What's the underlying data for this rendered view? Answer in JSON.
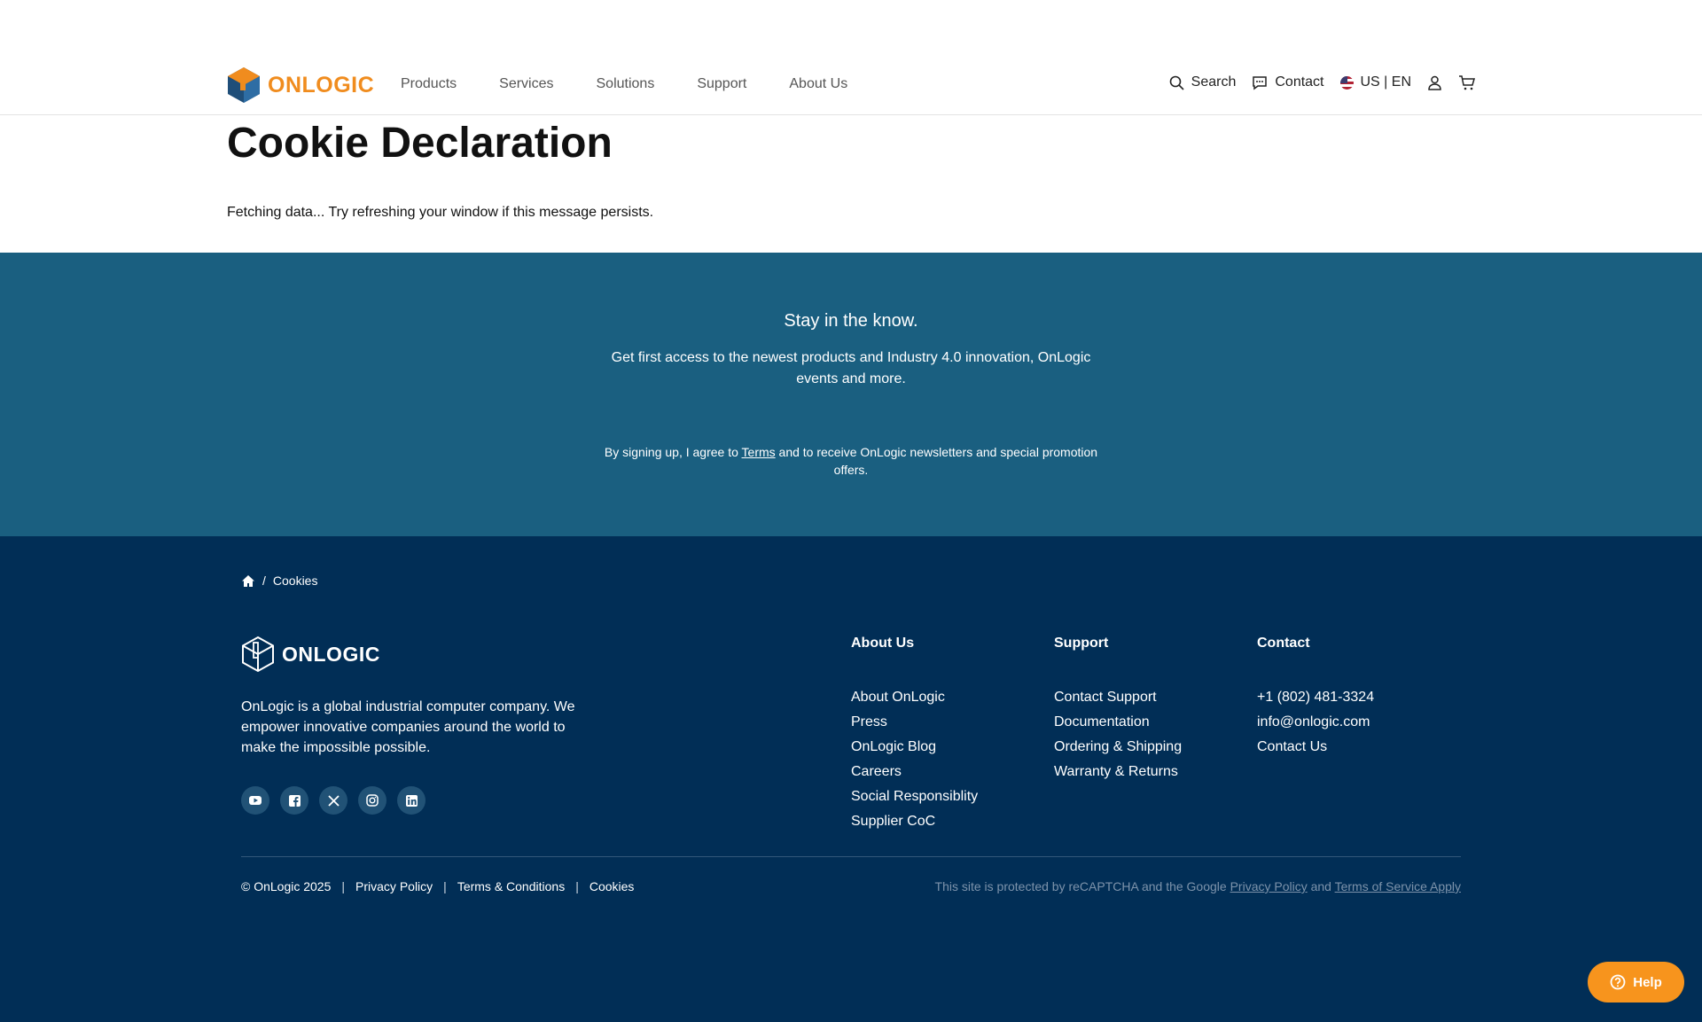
{
  "header": {
    "logo_text": "ONLOGIC",
    "nav": [
      "Products",
      "Services",
      "Solutions",
      "Support",
      "About Us"
    ],
    "search_label": "Search",
    "contact_label": "Contact",
    "locale_label": "US | EN"
  },
  "main": {
    "title": "Cookie Declaration",
    "status": "Fetching data... Try refreshing your window if this message persists."
  },
  "newsletter": {
    "title": "Stay in the know.",
    "description": "Get first access to the newest products and Industry 4.0 innovation, OnLogic events and more.",
    "terms_prefix": "By signing up, I agree to ",
    "terms_link": "Terms",
    "terms_suffix": " and to receive OnLogic newsletters and special promotion offers."
  },
  "footer": {
    "breadcrumb_sep": "/",
    "breadcrumb_current": "Cookies",
    "logo_text": "ONLOGIC",
    "about_text": "OnLogic is a global industrial computer company. We empower innovative companies around the world to make the impossible possible.",
    "columns": [
      {
        "title": "About Us",
        "links": [
          "About OnLogic",
          "Press",
          "OnLogic Blog",
          "Careers",
          "Social Responsiblity",
          "Supplier CoC"
        ]
      },
      {
        "title": "Support",
        "links": [
          "Contact Support",
          "Documentation",
          "Ordering & Shipping",
          "Warranty & Returns"
        ]
      },
      {
        "title": "Contact",
        "links": [
          "+1 (802) 481-3324",
          "info@onlogic.com",
          "Contact Us"
        ]
      }
    ],
    "copyright": "© OnLogic 2025",
    "legal_links": [
      "Privacy Policy",
      "Terms & Conditions",
      "Cookies"
    ],
    "legal_sep": "|",
    "recaptcha_prefix": "This site is protected by reCAPTCHA and the Google ",
    "recaptcha_privacy": "Privacy Policy",
    "recaptcha_and": " and ",
    "recaptcha_terms": "Terms of Service Apply"
  },
  "help_label": "Help",
  "colors": {
    "brand_orange": "#f08c1e",
    "newsletter_bg": "#1a5f80",
    "footer_bg": "#012e56",
    "help_bg": "#f7941d"
  },
  "icons": [
    "logo-cube-icon",
    "search-icon",
    "chat-icon",
    "us-flag-icon",
    "user-icon",
    "cart-icon",
    "home-icon",
    "youtube-icon",
    "facebook-icon",
    "x-icon",
    "instagram-icon",
    "linkedin-icon",
    "question-icon"
  ]
}
